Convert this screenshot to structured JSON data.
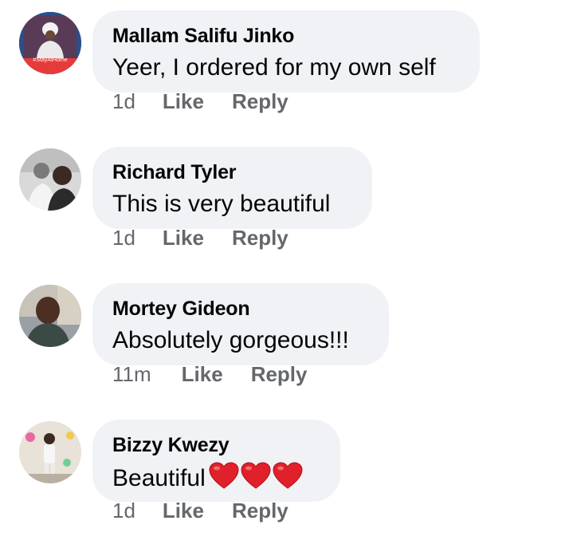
{
  "comments": [
    {
      "author": "Mallam Salifu Jinko",
      "text": "Yeer, I ordered for my own self",
      "time": "1d",
      "like_label": "Like",
      "reply_label": "Reply",
      "avatar_text": "#StayAtHome"
    },
    {
      "author": "Richard Tyler",
      "text": "This is very beautiful",
      "time": "1d",
      "like_label": "Like",
      "reply_label": "Reply"
    },
    {
      "author": "Mortey Gideon",
      "text": "Absolutely gorgeous!!!",
      "time": "11m",
      "like_label": "Like",
      "reply_label": "Reply"
    },
    {
      "author": "Bizzy Kwezy",
      "text": "Beautiful",
      "emoji": "red-heart x3",
      "time": "1d",
      "like_label": "Like",
      "reply_label": "Reply"
    }
  ],
  "colors": {
    "bubble": "#f0f2f5",
    "meta_text": "#65676b",
    "heart": "#e0202a"
  }
}
